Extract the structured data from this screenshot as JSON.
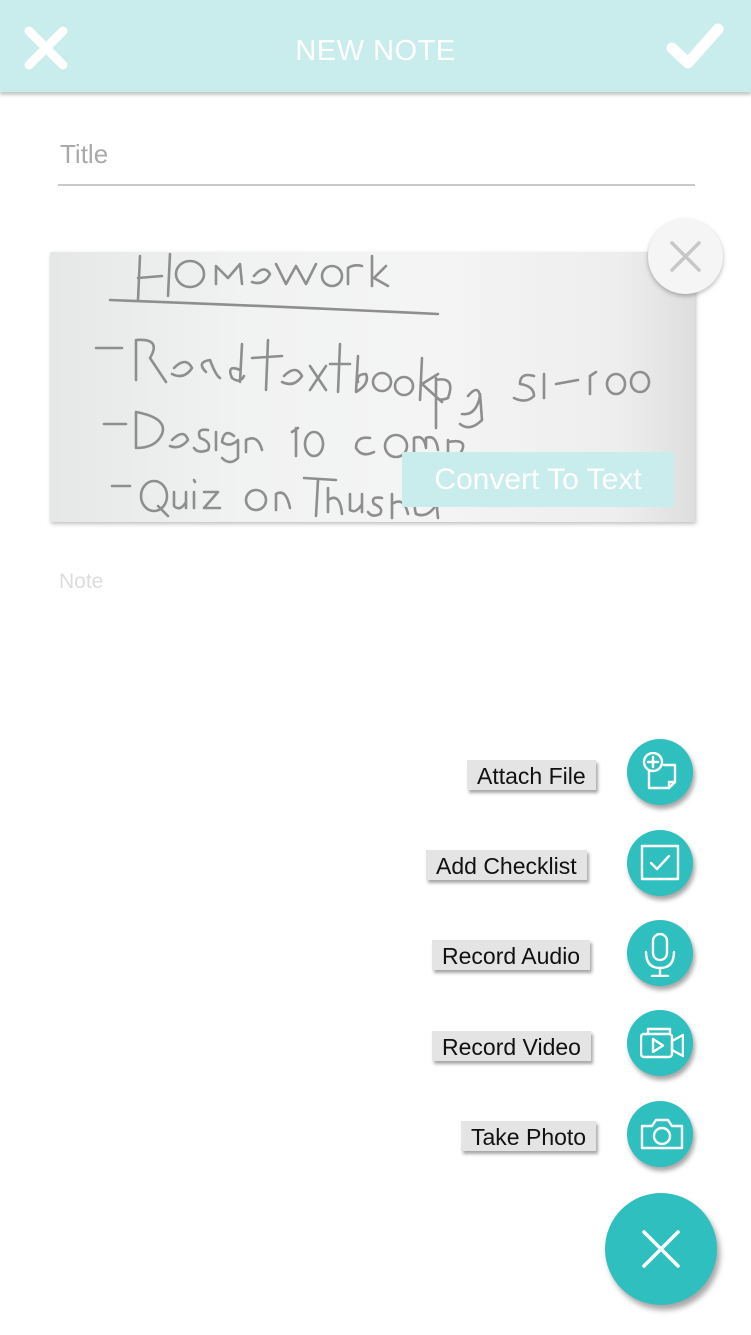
{
  "header": {
    "title": "NEW NOTE",
    "close_icon": "close-icon",
    "done_icon": "checkmark-icon",
    "background": "#c9ecec"
  },
  "title_field": {
    "placeholder": "Title",
    "value": ""
  },
  "attachment": {
    "type": "handwritten-photo",
    "handwriting_lines": [
      "Homework",
      "-Read textbook pg 51-100",
      "-Design 10 comp",
      "-Quiz on Thursday"
    ],
    "convert_label": "Convert To Text",
    "remove_icon": "close-icon"
  },
  "note_field": {
    "placeholder": "Note",
    "value": ""
  },
  "fab_menu": {
    "accent": "#2fbfbe",
    "items": [
      {
        "label": "Attach File",
        "icon": "attach-file-icon"
      },
      {
        "label": "Add Checklist",
        "icon": "checklist-icon"
      },
      {
        "label": "Record Audio",
        "icon": "microphone-icon"
      },
      {
        "label": "Record Video",
        "icon": "video-camera-icon"
      },
      {
        "label": "Take Photo",
        "icon": "camera-icon"
      }
    ],
    "toggle_icon": "close-icon"
  }
}
